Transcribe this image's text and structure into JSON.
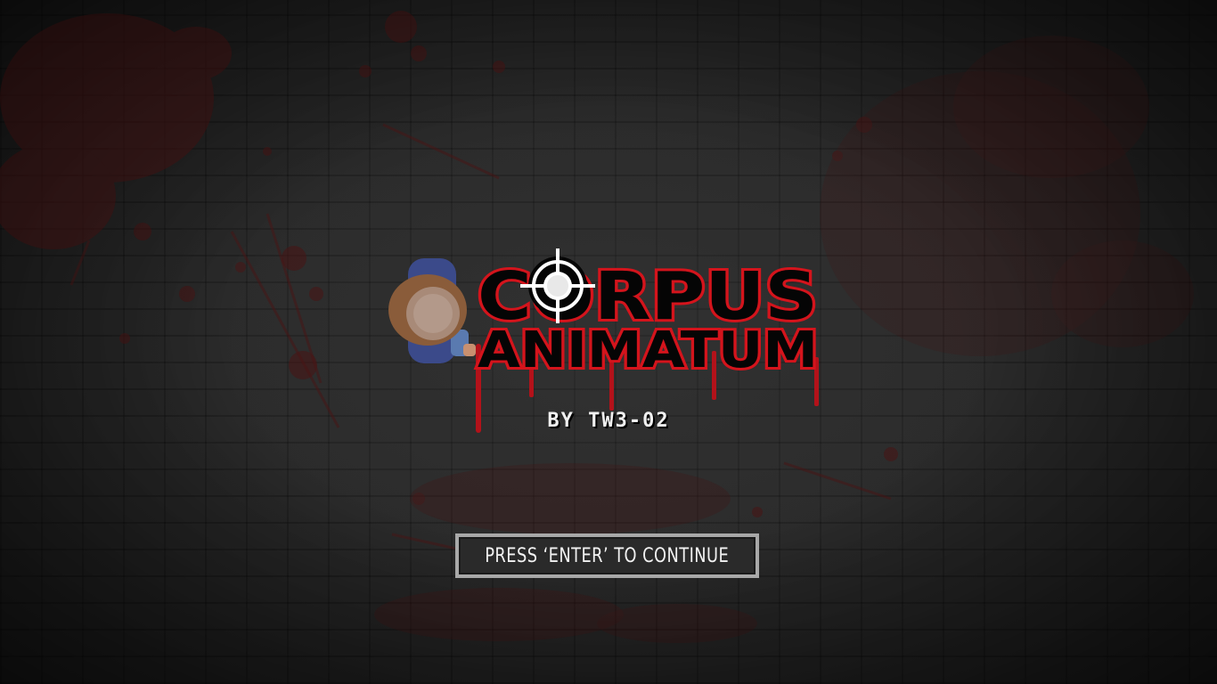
{
  "game": {
    "title_line1": "CORPUS",
    "title_line2": "ANIMATUM",
    "subtitle": "BY TW3-02",
    "prompt": "PRESS ‘ENTER’ TO CONTINUE"
  },
  "colors": {
    "background": "#2b2b2b",
    "title_fill": "#050505",
    "title_outline": "#d4141c",
    "blood": "#5a1212",
    "button_border": "#a8a8a8",
    "button_fill": "#2a2a2a",
    "text": "#f0f0f0"
  },
  "icons": {
    "logo_o": "crosshair-icon",
    "character": "player-character-icon"
  }
}
